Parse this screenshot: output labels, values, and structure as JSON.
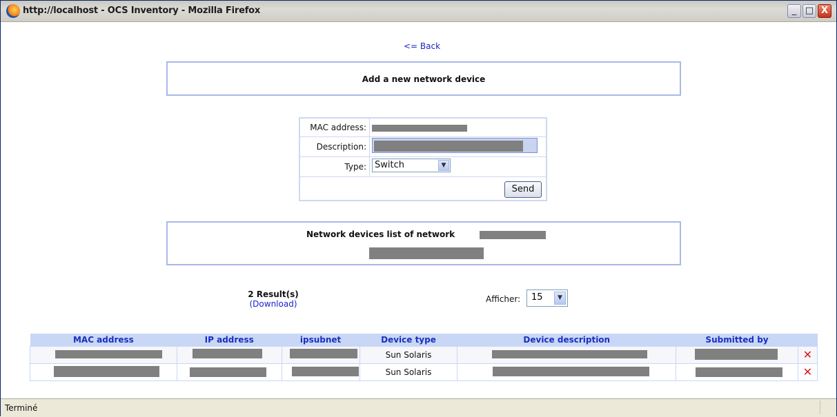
{
  "window": {
    "title": "http://localhost - OCS Inventory - Mozilla Firefox",
    "buttons": {
      "minimize": "_",
      "maximize": "□",
      "close": "X"
    }
  },
  "nav": {
    "back_label": "<= Back"
  },
  "add_section": {
    "title": "Add a new network device",
    "mac_label": "MAC address:",
    "description_label": "Description:",
    "type_label": "Type:",
    "type_value": "Switch",
    "send_label": "Send"
  },
  "list_section": {
    "title": "Network devices list of network"
  },
  "results": {
    "count_label": "2 Result(s)",
    "download_label": "(Download)",
    "afficher_label": "Afficher:",
    "afficher_value": "15"
  },
  "table": {
    "columns": [
      "MAC address",
      "IP address",
      "ipsubnet",
      "Device type",
      "Device description",
      "Submitted by"
    ],
    "rows": [
      {
        "device_type": "Sun Solaris"
      },
      {
        "device_type": "Sun Solaris"
      }
    ]
  },
  "status": {
    "text": "Terminé"
  },
  "icons": {
    "delete": "delete-x-icon",
    "dropdown": "chevron-down-icon",
    "browser": "firefox-icon"
  },
  "colors": {
    "link": "#1a25c9",
    "header_bg": "#c8d7f5",
    "delete": "#d9151b",
    "redacted": "#808080"
  }
}
